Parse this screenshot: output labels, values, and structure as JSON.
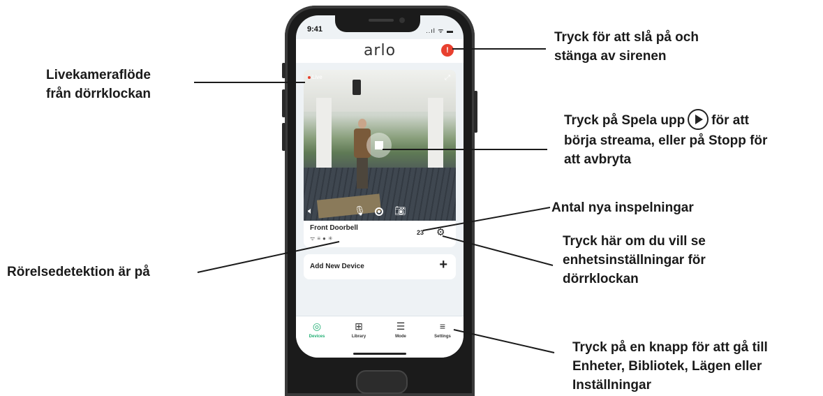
{
  "status_bar": {
    "time": "9:41",
    "icons": "..ıl ᯤ ▬"
  },
  "app": {
    "brand": "arlo",
    "siren_icon": "siren-icon"
  },
  "video": {
    "live_label": "Live"
  },
  "device": {
    "name": "Front Doorbell",
    "new_recordings": "23"
  },
  "add_device": {
    "label": "Add New Device",
    "plus": "+"
  },
  "tabs": [
    {
      "label": "Devices",
      "icon": "devices-icon",
      "active": true
    },
    {
      "label": "Library",
      "icon": "library-icon"
    },
    {
      "label": "Mode",
      "icon": "mode-icon"
    },
    {
      "label": "Settings",
      "icon": "settings-icon"
    }
  ],
  "callouts": {
    "live_feed": [
      "Livekameraflöde",
      "från dörrklockan"
    ],
    "siren": [
      "Tryck för att slå på och",
      "stänga av sirenen"
    ],
    "play": [
      "Tryck på Spela upp",
      "för att",
      "börja streama, eller på Stopp för",
      "att avbryta"
    ],
    "recordings": [
      "Antal nya inspelningar"
    ],
    "settings": [
      "Tryck här om du vill se",
      "enhetsinställningar för",
      "dörrklockan"
    ],
    "motion": [
      "Rörelsedetektion är på"
    ],
    "tabs": [
      "Tryck på en knapp för att gå till",
      "Enheter, Bibliotek, Lägen eller",
      "Inställningar"
    ]
  },
  "colors": {
    "accent_green": "#1fae72",
    "siren_red": "#e8402f",
    "phone_body": "#1b1b1b"
  }
}
